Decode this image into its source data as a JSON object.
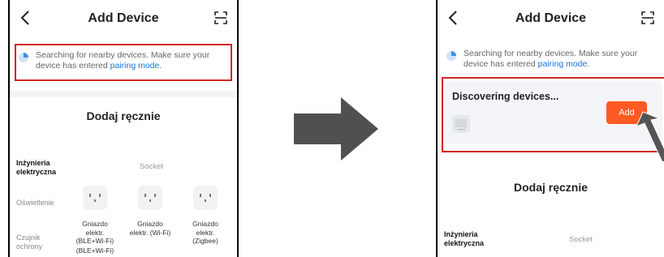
{
  "left_screen": {
    "title": "Add Device",
    "notice_prefix": "Searching for nearby devices. Make sure your device has entered ",
    "notice_link": "pairing mode.",
    "section_title": "Dodaj ręcznie",
    "categories": [
      "Inżynieria elektryczna",
      "Oświetlenie",
      "Czujnik ochrony"
    ],
    "subcategory": "Socket",
    "devices": [
      "Gniazdo elektr. (BLE+Wi-Fi)",
      "Gniazdo elektr. (Wi-Fi)",
      "Gniazdo elektr. (Zigbee)"
    ],
    "extra_label": "(BLE+Wi-Fi)"
  },
  "right_screen": {
    "title": "Add Device",
    "notice_prefix": "Searching for nearby devices. Make sure your device has entered ",
    "notice_link": "pairing mode.",
    "discovering_title": "Discovering devices...",
    "add_label": "Add",
    "section_title": "Dodaj ręcznie",
    "category": "Inżynieria elektryczna",
    "subcategory": "Socket"
  },
  "colors": {
    "highlight": "#d32626",
    "accent": "#ff5a23",
    "link": "#1a73d9",
    "arrow": "#505050"
  },
  "icons": [
    "back-icon",
    "scan-icon",
    "loading-spinner-icon",
    "socket-outlet-icon",
    "arrow-right-icon",
    "pointer-arrow-icon"
  ]
}
